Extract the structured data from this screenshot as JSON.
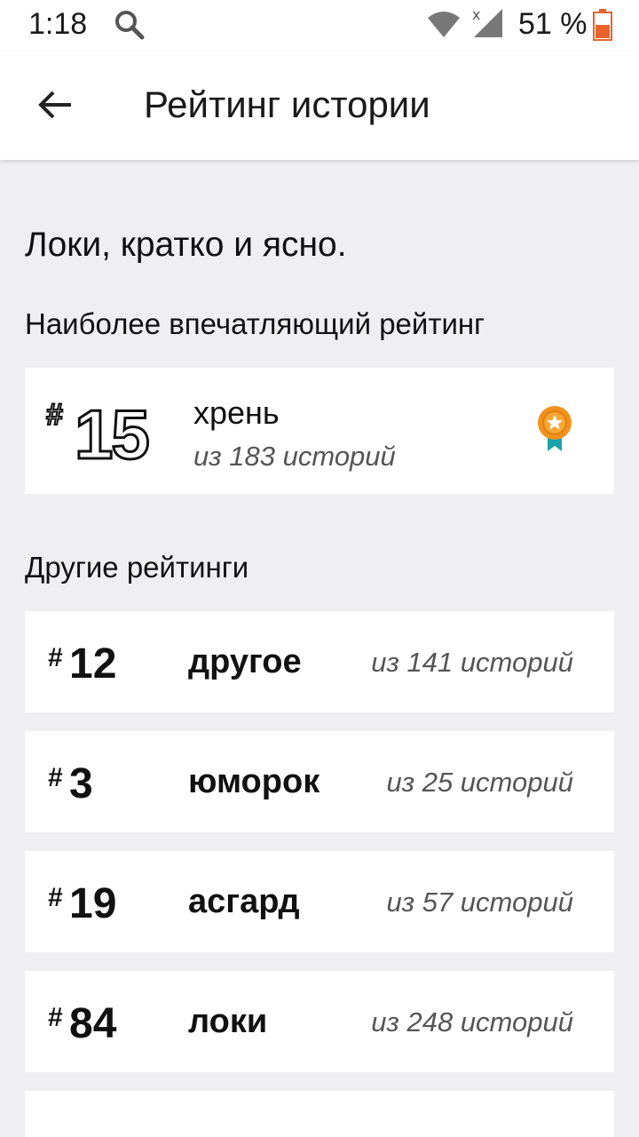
{
  "status": {
    "time": "1:18",
    "battery": "51 %"
  },
  "appbar": {
    "title": "Рейтинг истории"
  },
  "story": {
    "title": "Локи, кратко и ясно."
  },
  "best": {
    "heading": "Наиболее впечатляющий рейтинг",
    "hash": "#",
    "rank": "15",
    "tag": "хрень",
    "of": "из 183 историй"
  },
  "others": {
    "heading": "Другие рейтинги",
    "items": [
      {
        "hash": "#",
        "rank": "12",
        "tag": "другое",
        "of": "из 141 историй"
      },
      {
        "hash": "#",
        "rank": "3",
        "tag": "юморок",
        "of": "из 25 историй"
      },
      {
        "hash": "#",
        "rank": "19",
        "tag": "асгард",
        "of": "из 57 историй"
      },
      {
        "hash": "#",
        "rank": "84",
        "tag": "локи",
        "of": "из 248 историй"
      }
    ]
  },
  "icons": {
    "back": "arrow-back-icon",
    "search": "search-icon",
    "wifi": "wifi-icon",
    "signal": "signal-icon",
    "battery": "battery-icon",
    "badge": "award-ribbon-icon"
  },
  "colors": {
    "badge": "#f2921d",
    "ribbon": "#1aa3a8",
    "battery_fill": "#e8642b"
  }
}
